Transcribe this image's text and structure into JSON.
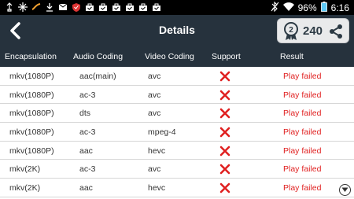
{
  "status_bar": {
    "notification_icons": [
      "usb-icon",
      "snowflake-icon",
      "wave-icon",
      "download-icon",
      "gmail-icon",
      "shield-icon",
      "bag-icon",
      "bag-icon",
      "bag-icon",
      "bag-icon",
      "bag-icon",
      "bag-icon"
    ],
    "battery_percent": "96%",
    "time": "6:16"
  },
  "title_bar": {
    "title": "Details",
    "score": "240"
  },
  "table": {
    "headers": [
      "Encapsulation",
      "Audio Coding",
      "Video Coding",
      "Support",
      "Result"
    ],
    "rows": [
      {
        "encapsulation": "mkv(1080P)",
        "audio": "aac(main)",
        "video": "avc",
        "support": "x",
        "result": "Play failed"
      },
      {
        "encapsulation": "mkv(1080P)",
        "audio": "ac-3",
        "video": "avc",
        "support": "x",
        "result": "Play failed"
      },
      {
        "encapsulation": "mkv(1080P)",
        "audio": "dts",
        "video": "avc",
        "support": "x",
        "result": "Play failed"
      },
      {
        "encapsulation": "mkv(1080P)",
        "audio": "ac-3",
        "video": "mpeg-4",
        "support": "x",
        "result": "Play failed"
      },
      {
        "encapsulation": "mkv(1080P)",
        "audio": "aac",
        "video": "hevc",
        "support": "x",
        "result": "Play failed"
      },
      {
        "encapsulation": "mkv(2K)",
        "audio": "ac-3",
        "video": "avc",
        "support": "x",
        "result": "Play failed"
      },
      {
        "encapsulation": "mkv(2K)",
        "audio": "aac",
        "video": "hevc",
        "support": "x",
        "result": "Play failed"
      }
    ]
  },
  "colors": {
    "header_bg": "#26323d",
    "fail_red": "#e02020"
  }
}
